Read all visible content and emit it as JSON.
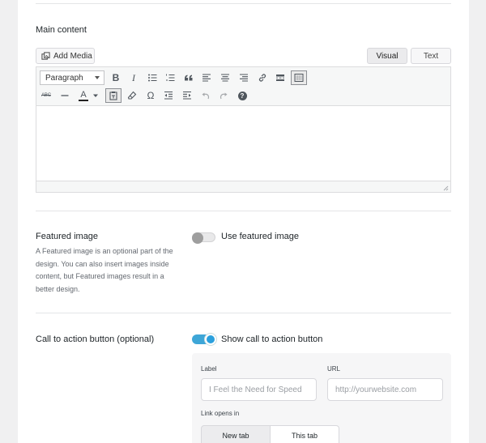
{
  "main_content": {
    "title": "Main content",
    "add_media_label": "Add Media",
    "tabs": {
      "visual": "Visual",
      "text": "Text"
    },
    "active_tab": "Visual",
    "toolbar": {
      "format_select": "Paragraph",
      "row1": [
        "bold-icon",
        "italic-icon",
        "bullet-list-icon",
        "numbered-list-icon",
        "blockquote-icon",
        "align-left-icon",
        "align-center-icon",
        "align-right-icon",
        "link-icon",
        "read-more-icon",
        "toolbar-toggle-icon"
      ],
      "row2": [
        "strikethrough-icon",
        "horizontal-line-icon",
        "text-color-icon",
        "paste-as-text-icon",
        "clear-formatting-icon",
        "special-character-icon",
        "outdent-icon",
        "indent-icon",
        "undo-icon",
        "redo-icon",
        "help-icon"
      ],
      "abc_label": "ABC",
      "text_color_letter": "A",
      "omega_glyph": "Ω",
      "bold_glyph": "B",
      "italic_glyph": "I",
      "help_glyph": "?"
    }
  },
  "featured_image": {
    "title": "Featured image",
    "description": "A Featured image is an optional part of the design. You can also insert images inside content, but Featured images result in a better design.",
    "toggle_label": "Use featured image",
    "enabled": false
  },
  "cta": {
    "title": "Call to action button (optional)",
    "toggle_label": "Show call to action button",
    "enabled": true,
    "label_field": {
      "label": "Label",
      "placeholder": "I Feel the Need for Speed"
    },
    "url_field": {
      "label": "URL",
      "placeholder": "http://yourwebsite.com"
    },
    "link_opens_in": {
      "label": "Link opens in",
      "options": [
        "New tab",
        "This tab"
      ],
      "selected": "New tab"
    }
  },
  "colors": {
    "accent": "#2ba0dd",
    "page_bg": "#f0f0f1",
    "panel_bg": "#ffffff"
  }
}
